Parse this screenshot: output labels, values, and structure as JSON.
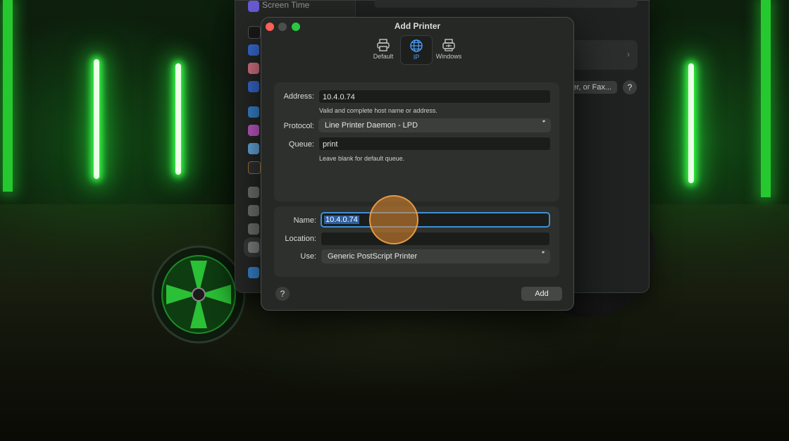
{
  "background": {
    "accent_green": "#38ff48"
  },
  "settings_window": {
    "sidebar_top_item": "Screen Time",
    "fax_button_label": "er, or Fax...",
    "help_label": "?"
  },
  "dialog": {
    "title": "Add Printer",
    "toolbar": [
      {
        "label": "Default",
        "icon": "printer-icon",
        "selected": false
      },
      {
        "label": "IP",
        "icon": "globe-icon",
        "selected": true
      },
      {
        "label": "Windows",
        "icon": "windows-printer-icon",
        "selected": false
      }
    ],
    "connection": {
      "address_label": "Address:",
      "address_value": "10.4.0.74",
      "address_hint": "Valid and complete host name or address.",
      "protocol_label": "Protocol:",
      "protocol_value": "Line Printer Daemon - LPD",
      "queue_label": "Queue:",
      "queue_value": "print",
      "queue_hint": "Leave blank for default queue."
    },
    "details": {
      "name_label": "Name:",
      "name_value": "10.4.0.74",
      "location_label": "Location:",
      "location_value": "",
      "use_label": "Use:",
      "use_value": "Generic PostScript Printer"
    },
    "help_label": "?",
    "add_label": "Add"
  }
}
